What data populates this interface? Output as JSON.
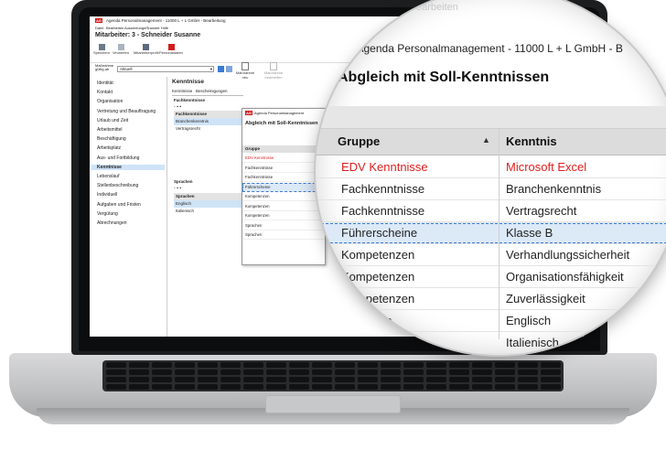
{
  "window": {
    "title": "Agenda Personalmanagement - 11000 L + L GmbH - Bearbeitung",
    "menu": [
      "Datei",
      "Bearbeiten",
      "Auswertungen",
      "Transfer",
      "Hilfe"
    ],
    "record_title": "Mitarbeiter: 3 - Schneider Susanne",
    "toolbar": [
      "Speichern",
      "Verwerfen",
      "Mitarbeiterprofil",
      "Personaldaten"
    ],
    "filter_label": "Maßnahme gültig ab",
    "filter_value": "Aktuell",
    "filter_actions": [
      "Maßnahme neu",
      "Maßnahme bearbeiten"
    ]
  },
  "sidebar": {
    "items": [
      "Identität",
      "Kontakt",
      "Organisation",
      "Vertretung und Beauftragung",
      "Urlaub und Zeit",
      "Arbeitsmittel",
      "Beschäftigung",
      "Arbeitsplatz",
      "Aus- und Fortbildung",
      "Kenntnisse",
      "Lebenslauf",
      "Stellenbeschreibung",
      "Individuell",
      "Aufgaben und Fristen",
      "Vergütung",
      "Abrechnungen"
    ],
    "selected_index": 9
  },
  "main": {
    "title": "Kenntnisse",
    "tabs": [
      "Kenntnisse",
      "Bescheinigungen"
    ],
    "group_fach": "Fachkenntnisse",
    "fach_header": "Fachkenntnisse",
    "fach_rows": [
      "Branchenkenntnis",
      "Vertragsrecht"
    ],
    "group_sprachen": "Sprachen",
    "sprachen_header": "Sprachen",
    "sprachen_rows": [
      "Englisch",
      "Italienisch"
    ]
  },
  "popup": {
    "title": "Agenda Personalmanagement",
    "heading": "Abgleich mit Soll-Kenntnissen",
    "col_group": "Gruppe",
    "rows": [
      "EDV Kenntnisse",
      "Fachkenntnisse",
      "Fachkenntnisse",
      "Führerscheine",
      "Kompetenzen",
      "Kompetenzen",
      "Kompetenzen",
      "Sprachen",
      "Sprachen"
    ]
  },
  "magnifier": {
    "titlebar": "Agenda Personalmanagement - 11000 L + L GmbH - B",
    "logo_text": "AG",
    "faint_text": "earbeiten",
    "heading": "Abgleich mit Soll-Kenntnissen",
    "col_group": "Gruppe",
    "col_skill": "Kenntnis",
    "sort_arrow": "▲",
    "rows": [
      {
        "group": "EDV Kenntnisse",
        "skill": "Microsoft Excel"
      },
      {
        "group": "Fachkenntnisse",
        "skill": "Branchenkenntnis"
      },
      {
        "group": "Fachkenntnisse",
        "skill": "Vertragsrecht"
      },
      {
        "group": "Führerscheine",
        "skill": "Klasse B"
      },
      {
        "group": "Kompetenzen",
        "skill": "Verhandlungssicherheit"
      },
      {
        "group": "Kompetenzen",
        "skill": "Organisationsfähigkeit"
      },
      {
        "group": "Kompetenzen",
        "skill": "Zuverlässigkeit"
      },
      {
        "group": "Sprachen",
        "skill": "Englisch"
      },
      {
        "group": "Sprachen",
        "skill": "Italienisch"
      }
    ],
    "highlight_color": "#e02020",
    "selected_row": 3
  }
}
